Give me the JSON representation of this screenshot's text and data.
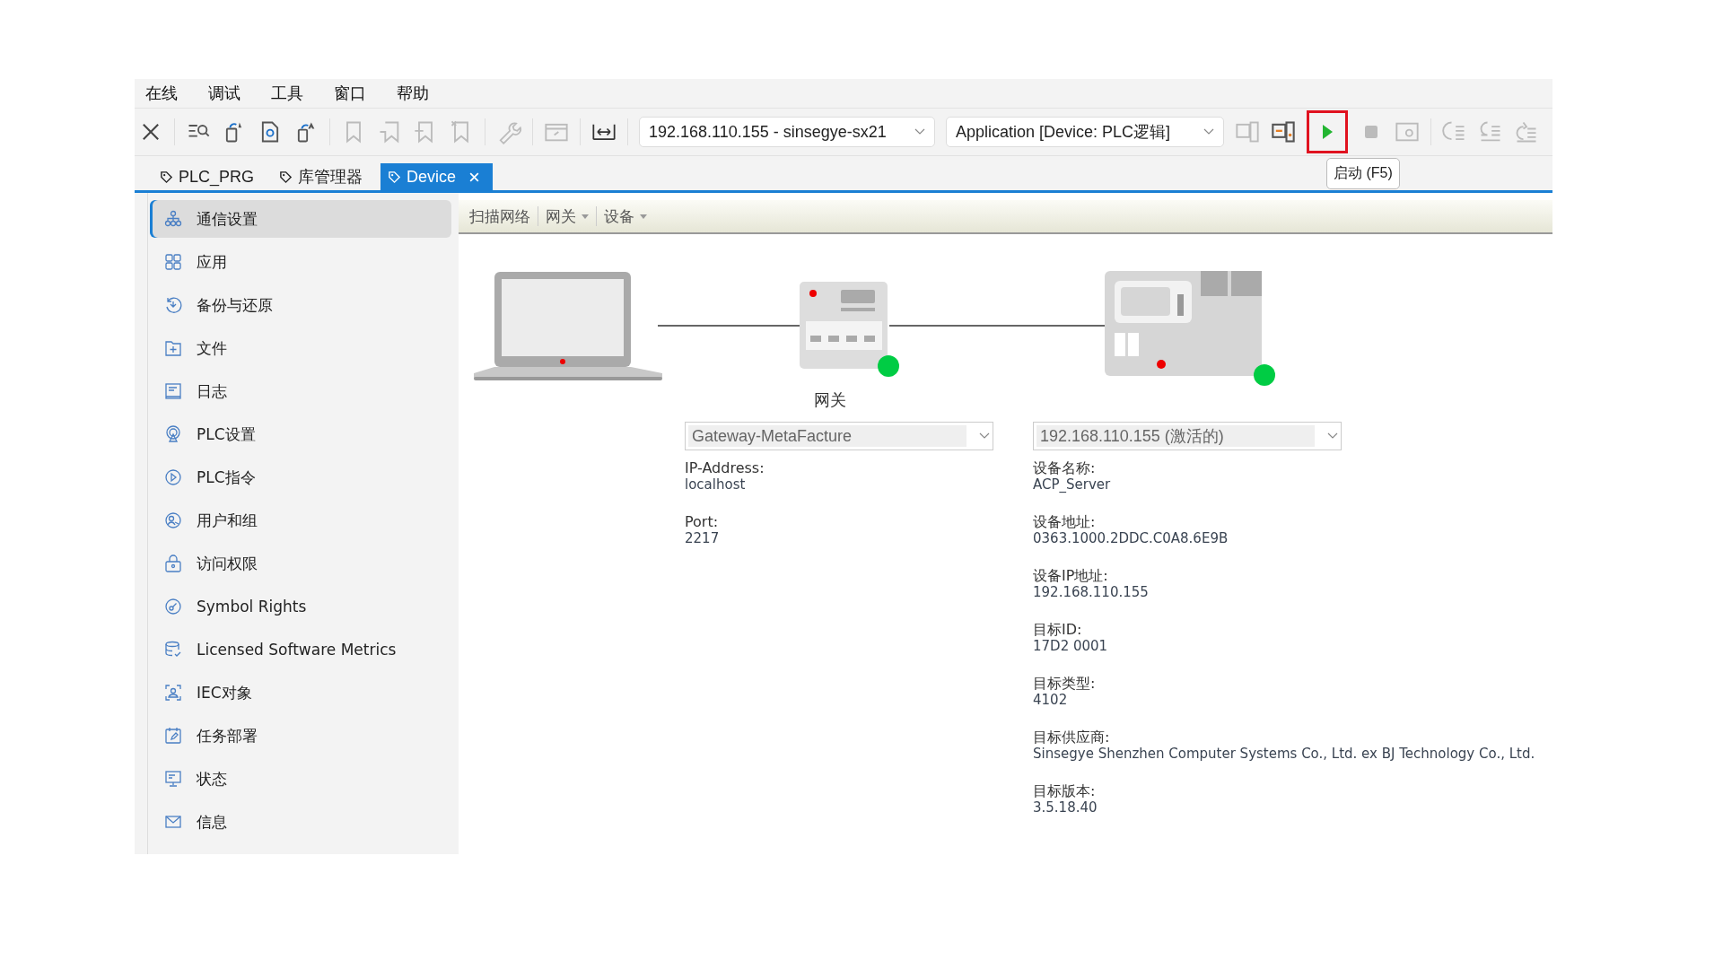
{
  "menu": [
    "在线",
    "调试",
    "工具",
    "窗口",
    "帮助"
  ],
  "toolbar": {
    "connection_select": "192.168.110.155 - sinsegye-sx21",
    "application_select": "Application [Device: PLC逻辑]",
    "run_button": {
      "highlighted": true,
      "tooltip": "启动 (F5)"
    }
  },
  "tabs": [
    {
      "label": "PLC_PRG",
      "selected": false
    },
    {
      "label": "库管理器",
      "selected": false
    },
    {
      "label": "Device",
      "selected": true
    }
  ],
  "sidebar": {
    "items": [
      {
        "label": "通信设置",
        "selected": true
      },
      {
        "label": "应用",
        "selected": false
      },
      {
        "label": "备份与还原",
        "selected": false
      },
      {
        "label": "文件",
        "selected": false
      },
      {
        "label": "日志",
        "selected": false
      },
      {
        "label": "PLC设置",
        "selected": false
      },
      {
        "label": "PLC指令",
        "selected": false
      },
      {
        "label": "用户和组",
        "selected": false
      },
      {
        "label": "访问权限",
        "selected": false
      },
      {
        "label": "Symbol Rights",
        "selected": false
      },
      {
        "label": "Licensed Software Metrics",
        "selected": false
      },
      {
        "label": "IEC对象",
        "selected": false
      },
      {
        "label": "任务部署",
        "selected": false
      },
      {
        "label": "状态",
        "selected": false
      },
      {
        "label": "信息",
        "selected": false
      }
    ]
  },
  "device_toolbar": [
    {
      "label": "扫描网络",
      "dropdown": false
    },
    {
      "label": "网关",
      "dropdown": true
    },
    {
      "label": "设备",
      "dropdown": true
    }
  ],
  "gateway": {
    "label": "网关",
    "online": true,
    "select": "Gateway-MetaFacture",
    "fields": [
      {
        "label": "IP-Address:",
        "value": "localhost"
      },
      {
        "label": "Port:",
        "value": "2217"
      }
    ]
  },
  "device": {
    "online": true,
    "select": "192.168.110.155 (激活的)",
    "fields": [
      {
        "label": "设备名称:",
        "value": "ACP_Server"
      },
      {
        "label": "设备地址:",
        "value": "0363.1000.2DDC.C0A8.6E9B"
      },
      {
        "label": "设备IP地址:",
        "value": "192.168.110.155"
      },
      {
        "label": "目标ID:",
        "value": "17D2 0001"
      },
      {
        "label": "目标类型:",
        "value": "4102"
      },
      {
        "label": "目标供应商:",
        "value": "Sinsegye Shenzhen Computer Systems Co., Ltd. ex BJ Technology Co., Ltd."
      },
      {
        "label": "目标版本:",
        "value": "3.5.18.40"
      }
    ]
  }
}
